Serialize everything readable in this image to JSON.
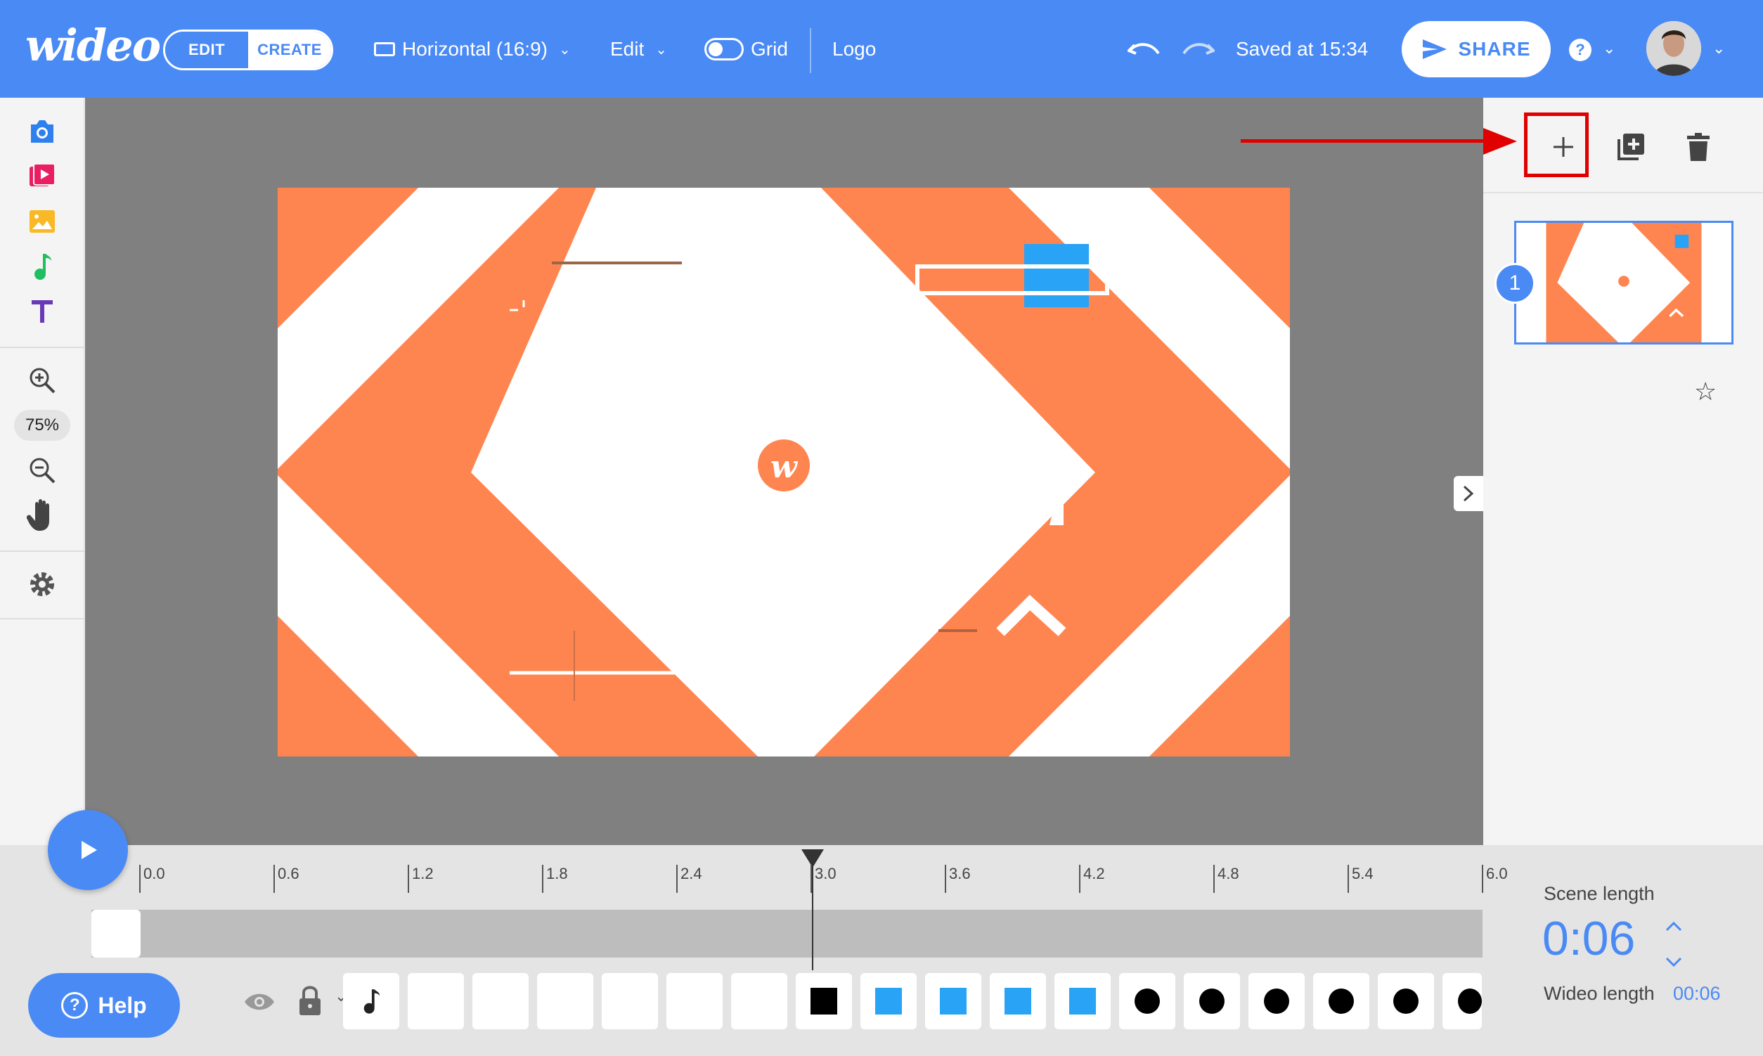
{
  "header": {
    "logo": "wideo",
    "mode_edit": "EDIT",
    "mode_create": "CREATE",
    "format": "Horizontal (16:9)",
    "edit_menu": "Edit",
    "grid_label": "Grid",
    "logo_link": "Logo",
    "saved_status": "Saved at 15:34",
    "share_label": "SHARE",
    "help_icon": "?"
  },
  "left_toolbar": {
    "tools": [
      "camera-icon",
      "video-icon",
      "image-icon",
      "music-icon",
      "text-icon"
    ],
    "zoom_level": "75%"
  },
  "right_panel": {
    "scene_number": "1"
  },
  "timeline": {
    "ruler": [
      "0.0",
      "0.6",
      "1.2",
      "1.8",
      "2.4",
      "3.0",
      "3.6",
      "4.2",
      "4.8",
      "5.4",
      "6.0"
    ],
    "playhead": "3.0",
    "scene_length_label": "Scene length",
    "scene_length": "0:06",
    "wideo_length_label": "Wideo length",
    "wideo_length": "00:06",
    "help_label": "Help"
  },
  "colors": {
    "brand_blue": "#4a8af4",
    "scene_orange": "#ff8550",
    "accent_blue": "#29a3f5",
    "highlight_red": "#e00000"
  }
}
